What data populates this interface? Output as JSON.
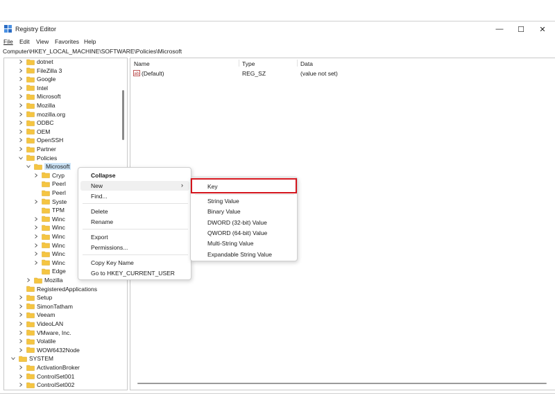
{
  "window": {
    "title": "Registry Editor",
    "minimize": "—",
    "maximize": "☐",
    "close": "✕"
  },
  "menubar": [
    {
      "label": "File"
    },
    {
      "label": "Edit"
    },
    {
      "label": "View"
    },
    {
      "label": "Favorites"
    },
    {
      "label": "Help"
    }
  ],
  "address": "Computer\\HKEY_LOCAL_MACHINE\\SOFTWARE\\Policies\\Microsoft",
  "tree": [
    {
      "label": "dotnet"
    },
    {
      "label": "FileZilla 3"
    },
    {
      "label": "Google"
    },
    {
      "label": "Intel"
    },
    {
      "label": "Microsoft"
    },
    {
      "label": "Mozilla"
    },
    {
      "label": "mozilla.org"
    },
    {
      "label": "ODBC"
    },
    {
      "label": "OEM"
    },
    {
      "label": "OpenSSH"
    },
    {
      "label": "Partner"
    },
    {
      "label": "Policies"
    },
    {
      "label": "Microsoft"
    },
    {
      "label": "Cryp"
    },
    {
      "label": "Peerl"
    },
    {
      "label": "Peerl"
    },
    {
      "label": "Syste"
    },
    {
      "label": "TPM"
    },
    {
      "label": "Winc"
    },
    {
      "label": "Winc"
    },
    {
      "label": "Winc"
    },
    {
      "label": "Winc"
    },
    {
      "label": "Winc"
    },
    {
      "label": "Winc"
    },
    {
      "label": "Edge"
    },
    {
      "label": "Mozilla"
    },
    {
      "label": "RegisteredApplications"
    },
    {
      "label": "Setup"
    },
    {
      "label": "SimonTatham"
    },
    {
      "label": "Veeam"
    },
    {
      "label": "VideoLAN"
    },
    {
      "label": "VMware, Inc."
    },
    {
      "label": "Volatile"
    },
    {
      "label": "WOW6432Node"
    },
    {
      "label": "SYSTEM"
    },
    {
      "label": "ActivationBroker"
    },
    {
      "label": "ControlSet001"
    },
    {
      "label": "ControlSet002"
    }
  ],
  "list": {
    "columns": [
      "Name",
      "Type",
      "Data"
    ],
    "rows": [
      {
        "name": "(Default)",
        "type": "REG_SZ",
        "data": "(value not set)"
      }
    ]
  },
  "context_menu": {
    "collapse": "Collapse",
    "new": "New",
    "find": "Find...",
    "delete": "Delete",
    "rename": "Rename",
    "export": "Export",
    "permissions": "Permissions...",
    "copy_key_name": "Copy Key Name",
    "goto": "Go to HKEY_CURRENT_USER"
  },
  "submenu": {
    "key": "Key",
    "string_value": "String Value",
    "binary_value": "Binary Value",
    "dword": "DWORD (32-bit) Value",
    "qword": "QWORD (64-bit) Value",
    "multi_string": "Multi-String Value",
    "expandable_string": "Expandable String Value"
  },
  "colors": {
    "folder": "#f5c542",
    "highlight": "#d4141c",
    "selection": "#cce4f7"
  }
}
